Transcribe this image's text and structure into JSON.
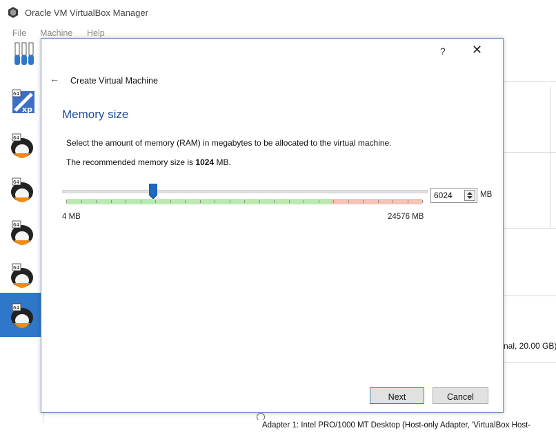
{
  "window": {
    "title": "Oracle VM VirtualBox Manager",
    "menu": [
      "File",
      "Machine",
      "Help"
    ]
  },
  "sidebar": {
    "vms": [
      {
        "icon": "windows-xp-64-icon"
      },
      {
        "icon": "linux-64-icon"
      },
      {
        "icon": "linux-64-icon"
      },
      {
        "icon": "linux-64-icon"
      },
      {
        "icon": "linux-64-icon"
      },
      {
        "icon": "linux-64-icon",
        "selected": true
      }
    ]
  },
  "details": {
    "storage_tail": "nal, 20.00 GB)",
    "network_line": "Adapter 1:   Intel PRO/1000 MT Desktop (Host-only Adapter, 'VirtualBox Host-"
  },
  "dialog": {
    "help_glyph": "?",
    "close_glyph": "✕",
    "back_glyph": "←",
    "wizard_title": "Create Virtual Machine",
    "heading": "Memory size",
    "description": "Select the amount of memory (RAM) in megabytes to be allocated to the virtual machine.",
    "recommended_prefix": "The recommended memory size is ",
    "recommended_value": "1024",
    "recommended_suffix": " MB.",
    "slider": {
      "min_label": "4 MB",
      "max_label": "24576 MB",
      "min": 4,
      "max": 24576,
      "value": 6024
    },
    "spin_value": "6024",
    "spin_unit": "MB",
    "next_label": "Next",
    "cancel_label": "Cancel"
  },
  "colors": {
    "accent": "#1f4e9b",
    "selection": "#2f77c9",
    "safe_range": "#b9ebb0",
    "danger_range": "#f6c3b6"
  }
}
